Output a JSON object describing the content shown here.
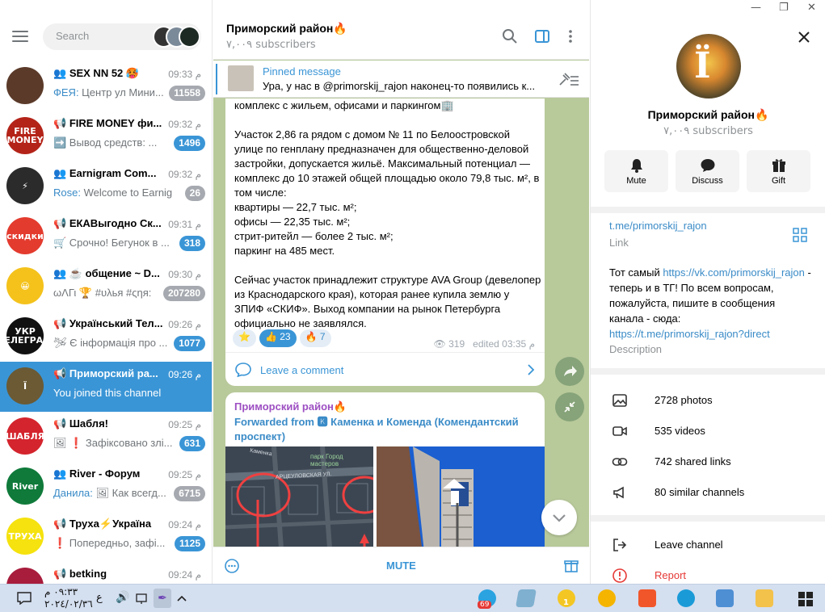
{
  "left": {
    "search_placeholder": "Search",
    "chats": [
      {
        "title": "SEX NN 52 🥵",
        "sender": "ФЕЯ:",
        "msg": " Центр ул Мини...",
        "time": "09:33 م",
        "badge": "11558",
        "badge_type": "gray",
        "kind": "group",
        "avatar_color": "#5b3a2a",
        "avatar_text": ""
      },
      {
        "title": "FIRE MONEY фи...",
        "sender": "",
        "msg": "➡️ Вывод средств: ...",
        "time": "09:32 م",
        "badge": "1496",
        "badge_type": "blue",
        "kind": "channel",
        "avatar_color": "#b42318",
        "avatar_text": "FIRE MONEY"
      },
      {
        "title": "Earnigram Com...",
        "sender": "Rose:",
        "msg": " Welcome to Earnig...",
        "time": "09:32 م",
        "badge": "26",
        "badge_type": "gray",
        "kind": "group",
        "avatar_color": "#2b2b2b",
        "avatar_text": "⚡"
      },
      {
        "title": "ЕКАВыгодно Ск...",
        "sender": "",
        "msg": "🛒 Срочно! Бегунок в ...",
        "time": "09:31 م",
        "badge": "318",
        "badge_type": "blue",
        "kind": "channel",
        "avatar_color": "#e33b2e",
        "avatar_text": "скидки"
      },
      {
        "title": "☕ общение ~ D...",
        "sender": "",
        "msg": "ωΛΓι 🏆 #υλья #ςηя:",
        "time": "09:30 م",
        "badge": "207280",
        "badge_type": "gray",
        "kind": "group",
        "avatar_color": "#f4c21b",
        "avatar_text": "😀"
      },
      {
        "title": "Український Тел...",
        "sender": "",
        "msg": "🛩 Є інформація про ...",
        "time": "09:26 م",
        "badge": "1077",
        "badge_type": "blue",
        "kind": "channel",
        "avatar_color": "#111111",
        "avatar_text": "УКР ТЕЛЕГРАМ"
      },
      {
        "title": "Приморский ра...",
        "sender": "",
        "msg": "You joined this channel",
        "time": "09:26 م",
        "badge": "",
        "badge_type": "none",
        "kind": "channel",
        "avatar_color": "#6b5a34",
        "avatar_text": "Ϊ"
      },
      {
        "title": "Шабля!",
        "sender": "",
        "msg": "🖼 ❗ Зафіксовано злі...",
        "time": "09:25 م",
        "badge": "631",
        "badge_type": "blue",
        "kind": "channel",
        "avatar_color": "#d4242d",
        "avatar_text": "ШАБЛЯ"
      },
      {
        "title": "River - Форум",
        "sender": "Данила:",
        "msg": " 🖼 Как всегд...",
        "time": "09:25 م",
        "badge": "6715",
        "badge_type": "gray",
        "kind": "group",
        "avatar_color": "#0f7a3a",
        "avatar_text": "River"
      },
      {
        "title": "Труха⚡Україна",
        "sender": "",
        "msg": "❗ Попередньо, зафі...",
        "time": "09:24 م",
        "badge": "1125",
        "badge_type": "blue",
        "kind": "channel",
        "avatar_color": "#f5e20e",
        "avatar_text": "ТРУХА"
      },
      {
        "title": "betking",
        "sender": "",
        "msg": "",
        "time": "09:24 م",
        "badge": "",
        "badge_type": "none",
        "kind": "channel",
        "avatar_color": "#a81c3c",
        "avatar_text": ""
      }
    ]
  },
  "mid": {
    "title": "Приморский район🔥",
    "subscribers": "٧,٠٠٩ subscribers",
    "pinned_title": "Pinned message",
    "pinned_text": "Ура, у нас в @primorskij_rajon наконец-то появились к...",
    "post_text": "комплекс с жильем, офисами и паркингом🏢\n\nУчасток 2,86 га рядом с домом № 11 по Белоостровской улице по генплану предназначен для общественно-деловой застройки, допускается жильё. Максимальный потенциал — комплекс до 10 этажей общей площадью около 79,8 тыс. м², в том числе:\nквартиры — 22,7 тыс. м²;\nофисы — 22,35 тыс. м²;\nстрит-ритейл — более 2 тыс. м²;\nпаркинг на 485 мест.\n\nСейчас участок принадлежит структуре AVA Group (девелопер из Краснодарского края), которая ранее купила землю у ЗПИФ «СКИФ». Выход компании на рынок Петербурга официально не заявлялся.",
    "reactions": [
      {
        "emoji": "⭐",
        "count": ""
      },
      {
        "emoji": "👍",
        "count": "23"
      },
      {
        "emoji": "🔥",
        "count": "7"
      }
    ],
    "views": "319",
    "edited": "edited 03:35 م",
    "comment_label": "Leave a comment",
    "post2_author": "Приморский район🔥",
    "post2_forwarded": "Forwarded from 🅺 Каменка и Коменда (Комендантский проспект)",
    "map_label": "парк Город мастеров",
    "map_street": "АРЦЕУЛОВСКАЯ УЛ.",
    "map_street2": "Каменка",
    "mute_label": "MUTE"
  },
  "right": {
    "name": "Приморский район🔥",
    "subscribers": "٧,٠٠٩ subscribers",
    "actions": [
      {
        "label": "Mute",
        "icon": "bell-icon"
      },
      {
        "label": "Discuss",
        "icon": "chat-bubble-icon"
      },
      {
        "label": "Gift",
        "icon": "gift-icon"
      }
    ],
    "link": "t.me/primorskij_rajon",
    "link_label": "Link",
    "desc_1": "Тот самый ",
    "desc_link1": "https://vk.com/primorskij_rajon",
    "desc_2": " - теперь и в ТГ! По всем вопросам, пожалуйста, пишите в сообщения канала - сюда: ",
    "desc_link2": "https://t.me/primorskij_rajon?direct",
    "desc_label": "Description",
    "media": [
      {
        "label": "2728 photos",
        "icon": "photo-icon"
      },
      {
        "label": "535 videos",
        "icon": "video-icon"
      },
      {
        "label": "742 shared links",
        "icon": "link-icon"
      },
      {
        "label": "80 similar channels",
        "icon": "megaphone-icon"
      }
    ],
    "leave": "Leave channel",
    "report": "Report"
  },
  "taskbar": {
    "time": "٠٩:٣٣ م",
    "date": "٢٠٢٤/٠٢/٣٦",
    "lang": "ع",
    "tg_badge": "69",
    "notif": "1"
  }
}
